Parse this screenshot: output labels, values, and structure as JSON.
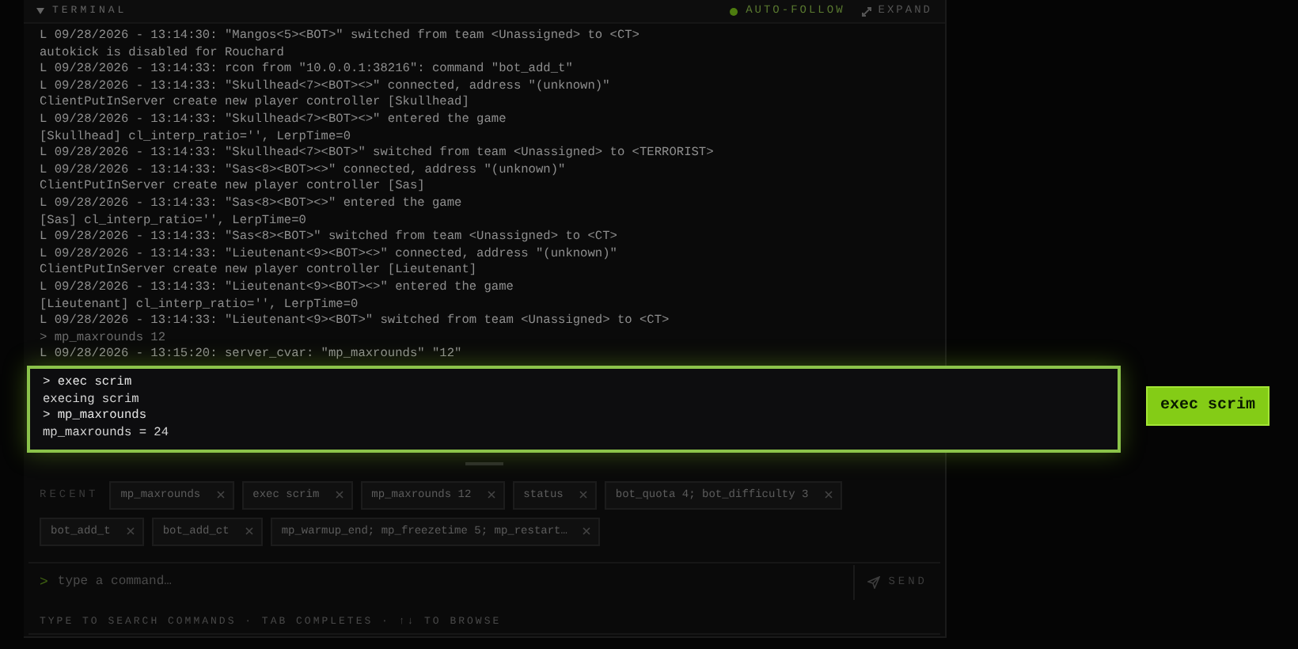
{
  "panel": {
    "title": "TERMINAL",
    "expanded": true,
    "auto_follow": {
      "label": "AUTO-FOLLOW",
      "on": true
    },
    "expand_label": "EXPAND"
  },
  "log_lines": [
    {
      "kind": "output",
      "text": "L 09/28/2026 - 13:14:30: \"Mangos<5><BOT>\" switched from team <Unassigned> to <CT>"
    },
    {
      "kind": "output",
      "text": "autokick is disabled for Rouchard"
    },
    {
      "kind": "output",
      "text": "L 09/28/2026 - 13:14:33: rcon from \"10.0.0.1:38216\": command \"bot_add_t\""
    },
    {
      "kind": "output",
      "text": "L 09/28/2026 - 13:14:33: \"Skullhead<7><BOT><>\" connected, address \"(unknown)\""
    },
    {
      "kind": "output",
      "text": "ClientPutInServer create new player controller [Skullhead]"
    },
    {
      "kind": "output",
      "text": "L 09/28/2026 - 13:14:33: \"Skullhead<7><BOT><>\" entered the game"
    },
    {
      "kind": "output",
      "text": "[Skullhead] cl_interp_ratio='', LerpTime=0"
    },
    {
      "kind": "output",
      "text": "L 09/28/2026 - 13:14:33: \"Skullhead<7><BOT>\" switched from team <Unassigned> to <TERRORIST>"
    },
    {
      "kind": "output",
      "text": "L 09/28/2026 - 13:14:33: \"Sas<8><BOT><>\" connected, address \"(unknown)\""
    },
    {
      "kind": "output",
      "text": "ClientPutInServer create new player controller [Sas]"
    },
    {
      "kind": "output",
      "text": "L 09/28/2026 - 13:14:33: \"Sas<8><BOT><>\" entered the game"
    },
    {
      "kind": "output",
      "text": "[Sas] cl_interp_ratio='', LerpTime=0"
    },
    {
      "kind": "output",
      "text": "L 09/28/2026 - 13:14:33: \"Sas<8><BOT>\" switched from team <Unassigned> to <CT>"
    },
    {
      "kind": "output",
      "text": "L 09/28/2026 - 13:14:33: \"Lieutenant<9><BOT><>\" connected, address \"(unknown)\""
    },
    {
      "kind": "output",
      "text": "ClientPutInServer create new player controller [Lieutenant]"
    },
    {
      "kind": "output",
      "text": "L 09/28/2026 - 13:14:33: \"Lieutenant<9><BOT><>\" entered the game"
    },
    {
      "kind": "output",
      "text": "[Lieutenant] cl_interp_ratio='', LerpTime=0"
    },
    {
      "kind": "output",
      "text": "L 09/28/2026 - 13:14:33: \"Lieutenant<9><BOT>\" switched from team <Unassigned> to <CT>"
    },
    {
      "kind": "command",
      "text": "> mp_maxrounds 12"
    },
    {
      "kind": "output",
      "text": "L 09/28/2026 - 13:15:20: server_cvar: \"mp_maxrounds\" \"12\""
    }
  ],
  "highlight": {
    "lines": [
      {
        "kind": "command",
        "text": "> exec scrim"
      },
      {
        "kind": "output",
        "text": "execing scrim"
      },
      {
        "kind": "command",
        "text": "> mp_maxrounds"
      },
      {
        "kind": "output",
        "text": "mp_maxrounds = 24"
      }
    ],
    "callout": "exec scrim"
  },
  "recent": {
    "label": "RECENT",
    "items": [
      "mp_maxrounds",
      "exec scrim",
      "mp_maxrounds 12",
      "status",
      "bot_quota 4; bot_difficulty 3",
      "bot_add_t",
      "bot_add_ct",
      "mp_warmup_end; mp_freezetime 5; mp_restart…"
    ]
  },
  "input": {
    "prompt": ">",
    "placeholder": "type a command…"
  },
  "send_label": "SEND",
  "hint": "TYPE TO SEARCH COMMANDS · TAB COMPLETES · ↑↓ TO BROWSE"
}
